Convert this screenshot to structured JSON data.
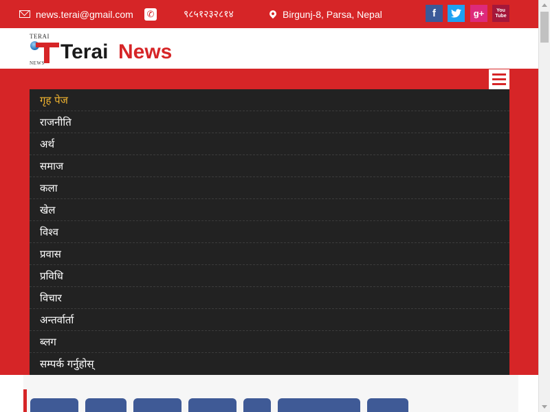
{
  "topbar": {
    "email": "news.terai@gmail.com",
    "phone": "९८५१२३२८१४",
    "address": "Birgunj-8, Parsa, Nepal",
    "social": [
      {
        "name": "facebook",
        "glyph": "f",
        "color": "#3b5998"
      },
      {
        "name": "twitter",
        "glyph": "t",
        "color": "#1da1f2"
      },
      {
        "name": "google-plus",
        "glyph": "g+",
        "color": "#dd4b39"
      },
      {
        "name": "youtube",
        "glyph": "You Tube",
        "color": "#b31217"
      }
    ]
  },
  "logo": {
    "small_top": "TERAI",
    "small_bottom": "NEWS",
    "brand_part1": "Terai",
    "brand_part2": "News"
  },
  "nav": {
    "items": [
      {
        "label": "गृह पेज",
        "active": true
      },
      {
        "label": "राजनीति"
      },
      {
        "label": "अर्थ"
      },
      {
        "label": "समाज"
      },
      {
        "label": "कला"
      },
      {
        "label": "खेल"
      },
      {
        "label": "विश्व"
      },
      {
        "label": "प्रवास"
      },
      {
        "label": "प्रविधि"
      },
      {
        "label": "विचार"
      },
      {
        "label": "अन्तर्वार्ता"
      },
      {
        "label": "ब्लग"
      },
      {
        "label": "सम्पर्क गर्नुहोस्"
      }
    ]
  },
  "colors": {
    "brand_red": "#d62527",
    "menu_bg": "#222222",
    "active_item": "#f2b530"
  }
}
